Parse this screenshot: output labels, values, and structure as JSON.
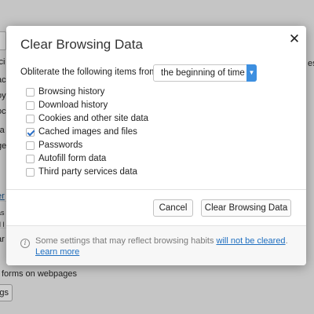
{
  "background": {
    "fragments": [
      "ici",
      "ac",
      "oy",
      "oc",
      "ra",
      "ge",
      "er",
      "as",
      "d l",
      "ar",
      "er"
    ],
    "right_fragment": "es",
    "forms_text": "forms on webpages",
    "button_label": "gs"
  },
  "dialog": {
    "title": "Clear Browsing Data",
    "close_glyph": "✕",
    "range_label": "Obliterate the following items from:",
    "range_value": "the beginning of time",
    "range_arrow_glyph": "⌄",
    "items": [
      {
        "label": "Browsing history",
        "checked": false
      },
      {
        "label": "Download history",
        "checked": false
      },
      {
        "label": "Cookies and other site data",
        "checked": false
      },
      {
        "label": "Cached images and files",
        "checked": true
      },
      {
        "label": "Passwords",
        "checked": false
      },
      {
        "label": "Autofill form data",
        "checked": false
      },
      {
        "label": "Third party services data",
        "checked": false
      }
    ],
    "cancel_label": "Cancel",
    "confirm_label": "Clear Browsing Data",
    "footer": {
      "info_glyph": "i",
      "text_before": "Some settings that may reflect browsing habits ",
      "link1": "will not be cleared",
      "text_after": ".",
      "link2": "Learn more"
    }
  },
  "colors": {
    "accent": "#3d8fe0",
    "link": "#1f6fc0",
    "checkmark": "#2a6fc7"
  }
}
